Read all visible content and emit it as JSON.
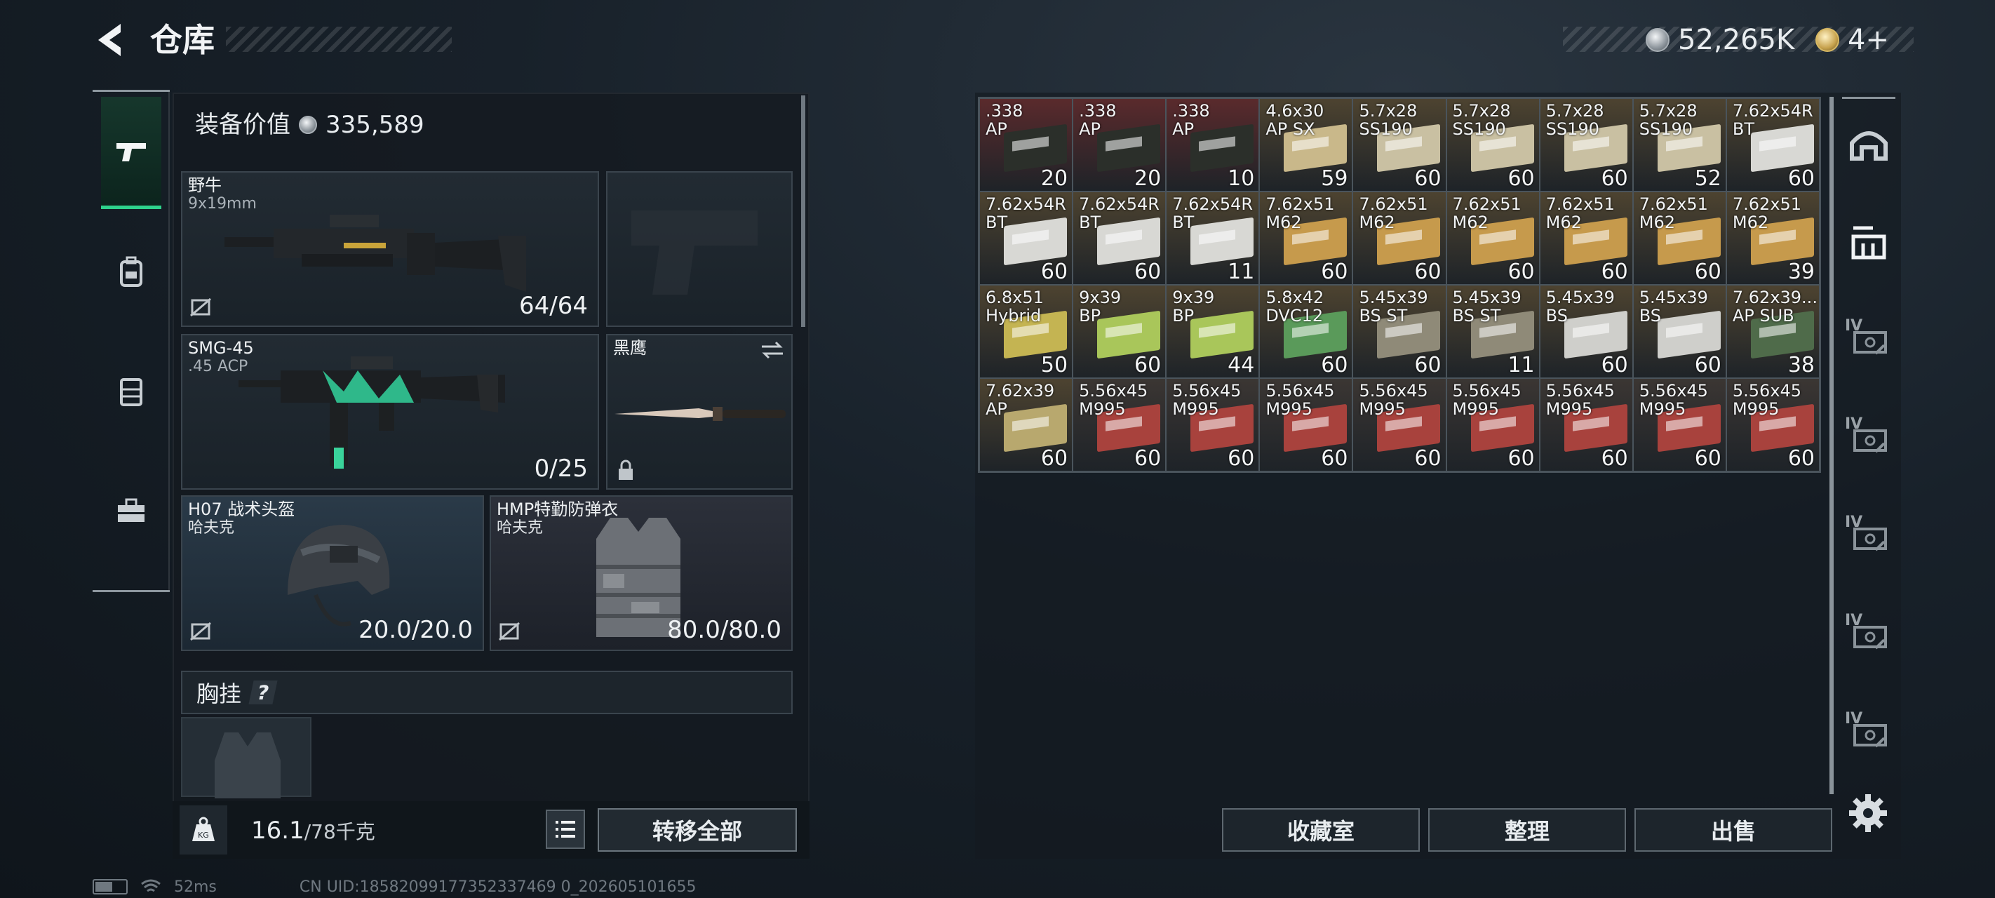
{
  "header": {
    "title": "仓库",
    "back_icon": "back-arrow-icon"
  },
  "currency": {
    "silver": "52,265K",
    "gold": "4+"
  },
  "left_tabs": [
    {
      "icon": "pistol-icon",
      "active": true
    },
    {
      "icon": "backpack-icon",
      "active": false
    },
    {
      "icon": "vest-icon",
      "active": false
    },
    {
      "icon": "toolbox-icon",
      "active": false
    }
  ],
  "loadout": {
    "equip_value_label": "装备价值",
    "equip_value": "335,589",
    "primary": {
      "name": "野牛",
      "ammo": "9x19mm",
      "count": "64/64"
    },
    "secondary": {
      "name": "SMG-45",
      "ammo": ".45 ACP",
      "count": "0/25"
    },
    "melee": {
      "name": "黑鹰"
    },
    "helmet": {
      "name": "H07 战术头盔",
      "brand": "哈夫克",
      "durability": "20.0/20.0"
    },
    "armor": {
      "name": "HMP特勤防弹衣",
      "brand": "哈夫克",
      "durability": "80.0/80.0"
    },
    "chest_label": "胸挂",
    "chest_help": "?",
    "weight_value": "16.1",
    "weight_max": "/78千克",
    "transfer_all": "转移全部"
  },
  "stash": {
    "items": [
      {
        "l1": ".338",
        "l2": "AP",
        "count": "20",
        "color": "#2b2f2a",
        "bg": "#5a2a2c"
      },
      {
        "l1": ".338",
        "l2": "AP",
        "count": "20",
        "color": "#2b2f2a",
        "bg": "#5a2a2c"
      },
      {
        "l1": ".338",
        "l2": "AP",
        "count": "10",
        "color": "#2b2f2a",
        "bg": "#5a2a2c"
      },
      {
        "l1": "4.6x30",
        "l2": "AP SX",
        "count": "59",
        "color": "#c9b88a",
        "bg": "#4d4330"
      },
      {
        "l1": "5.7x28",
        "l2": "SS190",
        "count": "60",
        "color": "#c9c0a2",
        "bg": "#4d4330"
      },
      {
        "l1": "5.7x28",
        "l2": "SS190",
        "count": "60",
        "color": "#c9c0a2",
        "bg": "#4d4330"
      },
      {
        "l1": "5.7x28",
        "l2": "SS190",
        "count": "60",
        "color": "#c9c0a2",
        "bg": "#4d4330"
      },
      {
        "l1": "5.7x28",
        "l2": "SS190",
        "count": "52",
        "color": "#c9c0a2",
        "bg": "#4d4330"
      },
      {
        "l1": "7.62x54R",
        "l2": "BT",
        "count": "60",
        "color": "#d8d8d4",
        "bg": "#4d4330"
      },
      {
        "l1": "7.62x54R",
        "l2": "BT",
        "count": "60",
        "color": "#d8d8d4",
        "bg": "#4d4330"
      },
      {
        "l1": "7.62x54R",
        "l2": "BT",
        "count": "60",
        "color": "#d8d8d4",
        "bg": "#4d4330"
      },
      {
        "l1": "7.62x54R",
        "l2": "BT",
        "count": "11",
        "color": "#d8d8d4",
        "bg": "#4d4330"
      },
      {
        "l1": "7.62x51",
        "l2": "M62",
        "count": "60",
        "color": "#c69a4c",
        "bg": "#4d4330"
      },
      {
        "l1": "7.62x51",
        "l2": "M62",
        "count": "60",
        "color": "#c69a4c",
        "bg": "#4d4330"
      },
      {
        "l1": "7.62x51",
        "l2": "M62",
        "count": "60",
        "color": "#c69a4c",
        "bg": "#4d4330"
      },
      {
        "l1": "7.62x51",
        "l2": "M62",
        "count": "60",
        "color": "#c69a4c",
        "bg": "#4d4330"
      },
      {
        "l1": "7.62x51",
        "l2": "M62",
        "count": "60",
        "color": "#c69a4c",
        "bg": "#4d4330"
      },
      {
        "l1": "7.62x51",
        "l2": "M62",
        "count": "39",
        "color": "#c69a4c",
        "bg": "#4d4330"
      },
      {
        "l1": "6.8x51",
        "l2": "Hybrid",
        "count": "50",
        "color": "#c4b452",
        "bg": "#4d4330"
      },
      {
        "l1": "9x39",
        "l2": "BP",
        "count": "60",
        "color": "#a9c65a",
        "bg": "#4d4330"
      },
      {
        "l1": "9x39",
        "l2": "BP",
        "count": "44",
        "color": "#a9c65a",
        "bg": "#4d4330"
      },
      {
        "l1": "5.8x42",
        "l2": "DVC12",
        "count": "60",
        "color": "#5a9a5a",
        "bg": "#4d4330"
      },
      {
        "l1": "5.45x39",
        "l2": "BS ST",
        "count": "60",
        "color": "#8f8a78",
        "bg": "#4d4330"
      },
      {
        "l1": "5.45x39",
        "l2": "BS ST",
        "count": "11",
        "color": "#8f8a78",
        "bg": "#4d4330"
      },
      {
        "l1": "5.45x39",
        "l2": "BS",
        "count": "60",
        "color": "#cfcfcb",
        "bg": "#4d4330"
      },
      {
        "l1": "5.45x39",
        "l2": "BS",
        "count": "60",
        "color": "#cfcfcb",
        "bg": "#4d4330"
      },
      {
        "l1": "7.62x39...",
        "l2": "AP SUB",
        "count": "38",
        "color": "#4f6b4a",
        "bg": "#4d4330"
      },
      {
        "l1": "7.62x39",
        "l2": "AP",
        "count": "60",
        "color": "#b8a86e",
        "bg": "#4d4330"
      },
      {
        "l1": "5.56x45",
        "l2": "M995",
        "count": "60",
        "color": "#a8423d",
        "bg": "#3b3633"
      },
      {
        "l1": "5.56x45",
        "l2": "M995",
        "count": "60",
        "color": "#a8423d",
        "bg": "#3b3633"
      },
      {
        "l1": "5.56x45",
        "l2": "M995",
        "count": "60",
        "color": "#a8423d",
        "bg": "#3b3633"
      },
      {
        "l1": "5.56x45",
        "l2": "M995",
        "count": "60",
        "color": "#a8423d",
        "bg": "#3b3633"
      },
      {
        "l1": "5.56x45",
        "l2": "M995",
        "count": "60",
        "color": "#a8423d",
        "bg": "#3b3633"
      },
      {
        "l1": "5.56x45",
        "l2": "M995",
        "count": "60",
        "color": "#a8423d",
        "bg": "#3b3633"
      },
      {
        "l1": "5.56x45",
        "l2": "M995",
        "count": "60",
        "color": "#a8423d",
        "bg": "#3b3633"
      },
      {
        "l1": "5.56x45",
        "l2": "M995",
        "count": "60",
        "color": "#a8423d",
        "bg": "#3b3633"
      }
    ],
    "buttons": {
      "collection": "收藏室",
      "sort": "整理",
      "sell": "出售"
    }
  },
  "right_tabs": [
    {
      "icon": "dome-icon",
      "label": ""
    },
    {
      "icon": "shelf-icon",
      "label": ""
    },
    {
      "icon": "locked-stash-icon",
      "label": "IV"
    },
    {
      "icon": "locked-stash-icon",
      "label": "IV"
    },
    {
      "icon": "locked-stash-icon",
      "label": "IV"
    },
    {
      "icon": "locked-stash-icon",
      "label": "IV"
    },
    {
      "icon": "locked-stash-icon",
      "label": "IV"
    }
  ],
  "status": {
    "ping": "52ms",
    "uid": "CN UID:18582099177352337469 0_202605101655"
  }
}
